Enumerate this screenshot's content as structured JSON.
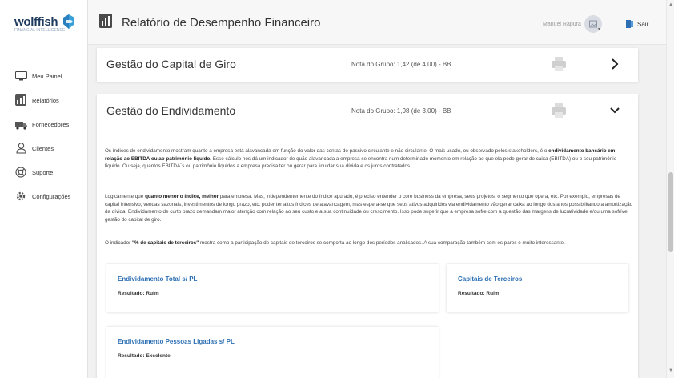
{
  "app": {
    "logo_text": "wolffish",
    "logo_sub": "FINANCIAL INTELLIGENCE"
  },
  "sidebar": {
    "items": [
      {
        "label": "Meu Painel",
        "icon": "monitor-icon"
      },
      {
        "label": "Relatórios",
        "icon": "reports-icon"
      },
      {
        "label": "Fornecedores",
        "icon": "suppliers-icon"
      },
      {
        "label": "Clientes",
        "icon": "clients-icon"
      },
      {
        "label": "Suporte",
        "icon": "support-icon"
      },
      {
        "label": "Configurações",
        "icon": "settings-icon"
      }
    ]
  },
  "header": {
    "title": "Relatório de Desempenho Financeiro",
    "user_name": "Manuel Rapura",
    "logout_label": "Sair"
  },
  "sections": {
    "working_capital": {
      "title": "Gestão do Capital de Giro",
      "grade": "Nota do Grupo: 1,42 (de 4,00) - BB"
    },
    "debt": {
      "title": "Gestão do Endividamento",
      "grade": "Nota do Grupo: 1,98 (de 3,00) - BB",
      "p1_a": "Os índices de endividamento mostram quanto a empresa está alavancada em função do valor das contas do passivo circulante e não circulante. O mais usado, ou observado pelos stakeholders, é o ",
      "p1_bold": "endividamento bancário em relação ao EBITDA ou ao patrimônio líquido.",
      "p1_b": " Esse cálculo nos dá um indicador de quão alavancada a empresa se encontra num determinado momento em relação ao que ela pode gerar de caixa (EBITDA) ou o seu patrimônio líquido. Ou seja, quantos EBITDA´s ou patrimônio líquidos a empresa precisa ter ou gerar para liquidar sua dívida e os juros contratados.",
      "p2_a": "Logicamente que ",
      "p2_bold": "quanto menor o índice, melhor",
      "p2_b": " para empresa. Mas, independentemente do índice apurado, é preciso entender o core business da empresa, seus projetos, o segmento que opera, etc. Por exemplo, empresas de capital intensivo, vendas sazonais, investimentos de longo prazo, etc. poder ter altos índices de alavancagem, mas espera-se que seus ativos adquiridos via endividamento vão gerar caixa ao longo dos anos possibilitando a amortização da dívida. Endividamento de curto prazo demandam maior atenção com relação ao seu custo e a sua continuidade ou crescimento. Isso pode sugerir que a empresa sofre com a questão das margens de lucratividade e/ou uma sofrível gestão do capital de giro.",
      "p3_a": "O indicador ",
      "p3_bold": "\"% de capitais de terceiros\"",
      "p3_b": " mostra como a participação de capitais de terceiros se comporta ao longo dos períodos analisados. A sua comparação também com os pares é muito interessante."
    }
  },
  "cards": [
    {
      "title": "Endividamento Total s/ PL",
      "result_label": "Resultado:",
      "result_value": "Ruim"
    },
    {
      "title": "Capitais de Terceiros",
      "result_label": "Resultado:",
      "result_value": "Ruim"
    },
    {
      "title": "Endividamento Pessoas Ligadas s/ PL",
      "result_label": "Resultado:",
      "result_value": "Excelente"
    }
  ],
  "colors": {
    "accent": "#2c6fb3",
    "logo": "#1f3a5f",
    "logo_mark": "#3aa0d8"
  }
}
